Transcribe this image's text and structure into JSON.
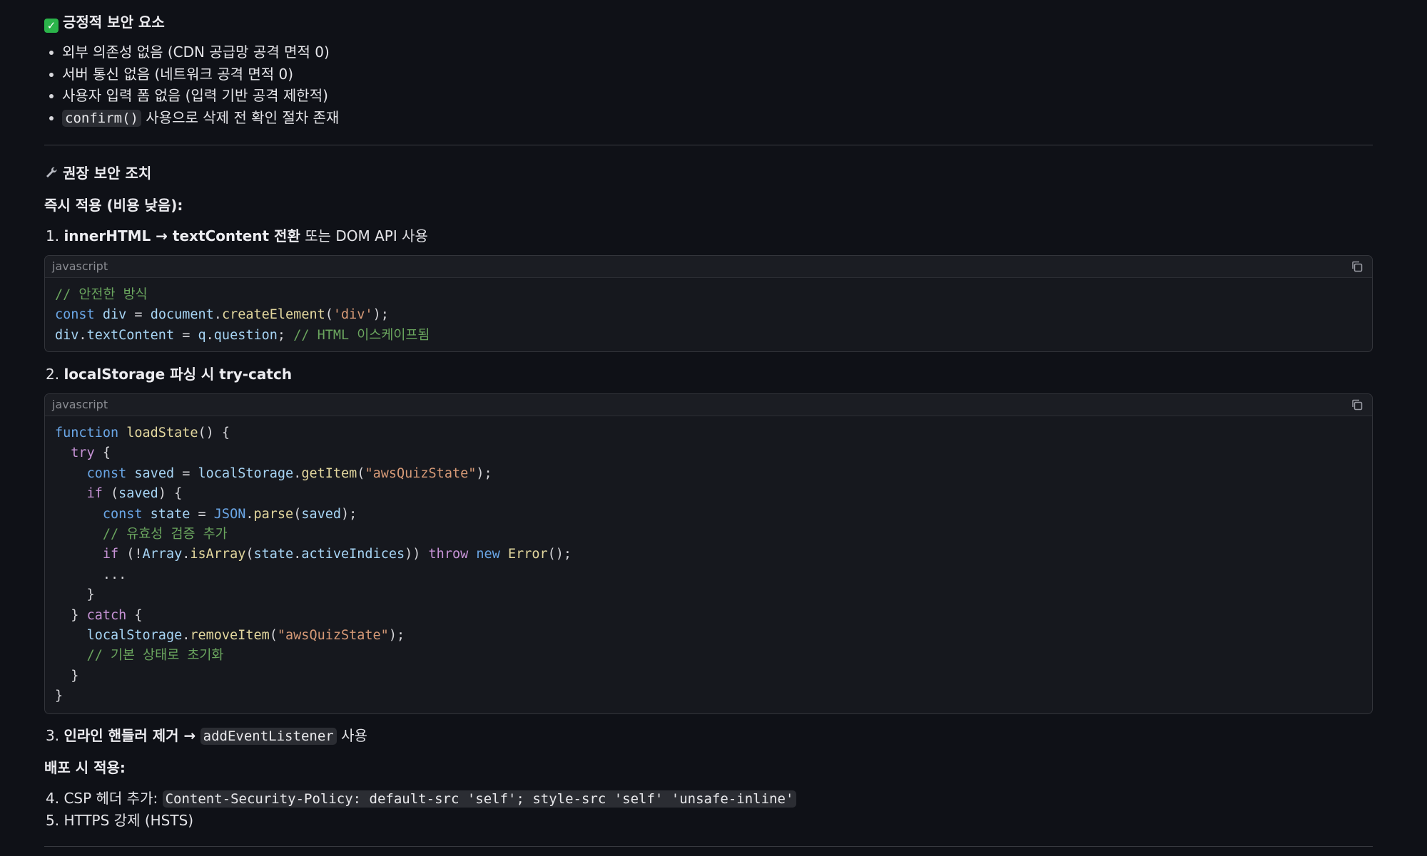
{
  "section_positive": {
    "title": "긍정적 보안 요소",
    "items": [
      "외부 의존성 없음 (CDN 공급망 공격 면적 0)",
      "서버 통신 없음 (네트워크 공격 면적 0)",
      "사용자 입력 폼 없음 (입력 기반 공격 제한적)"
    ],
    "item4_code": "confirm()",
    "item4_text": " 사용으로 삭제 전 확인 절차 존재"
  },
  "section_recommend": {
    "title": "권장 보안 조치",
    "immediate_label": "즉시 적용 (비용 낮음):",
    "step1_num": "1.",
    "step1_bold": "innerHTML → textContent 전환",
    "step1_rest": " 또는 DOM API 사용",
    "code1_lang": "javascript",
    "step2_num": "2.",
    "step2_bold": "localStorage 파싱 시 try-catch",
    "code2_lang": "javascript",
    "step3_num": "3.",
    "step3_bold": "인라인 핸들러 제거 →",
    "step3_code": "addEventListener",
    "step3_rest": "사용",
    "deploy_label": "배포 시 적용:",
    "step4_text": "4. CSP 헤더 추가:",
    "step4_code": "Content-Security-Policy: default-src 'self'; style-src 'self' 'unsafe-inline'",
    "step5_text": "5. HTTPS 강제 (HSTS)"
  },
  "icons": {
    "check": "white-check-mark-icon",
    "wrench": "wrench-icon",
    "copy": "copy-icon"
  },
  "colors": {
    "background": "#0f1117",
    "code_background": "#16181e",
    "keyword": "#6aa6e6",
    "control": "#c793d6",
    "function": "#e3d79e",
    "string": "#d79a77",
    "comment": "#6aa55e",
    "variable": "#a7d5f5"
  }
}
